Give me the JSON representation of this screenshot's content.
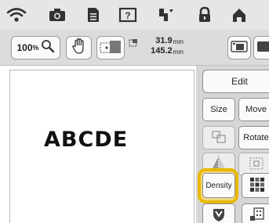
{
  "topbar": {
    "icons": [
      "wifi-icon",
      "camera-icon",
      "document-icon",
      "help-icon",
      "threading-icon",
      "lock-icon",
      "home-icon"
    ]
  },
  "toolbar": {
    "zoom_value": "100",
    "zoom_unit": "%",
    "width_value": "31.9",
    "height_value": "145.2",
    "unit": "mm"
  },
  "canvas": {
    "text": "ABCDE"
  },
  "panel": {
    "edit_label": "Edit",
    "size_label": "Size",
    "move_label": "Move",
    "rotate_label": "Rotate",
    "density_label": "Density"
  },
  "colors": {
    "highlight": "#e8b800",
    "toolbar_bg": "#e6e6e6",
    "panel_bg": "#d6d6d6"
  }
}
